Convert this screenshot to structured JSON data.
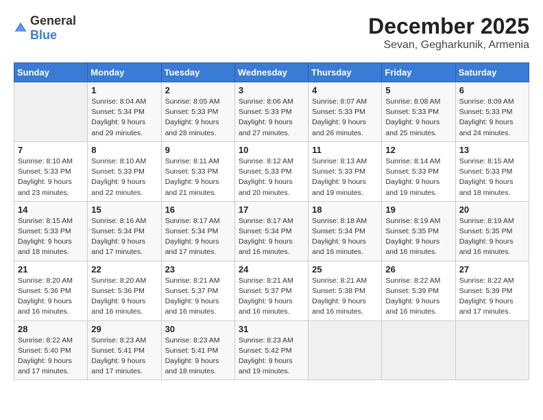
{
  "header": {
    "logo_general": "General",
    "logo_blue": "Blue",
    "month": "December 2025",
    "location": "Sevan, Gegharkunik, Armenia"
  },
  "weekdays": [
    "Sunday",
    "Monday",
    "Tuesday",
    "Wednesday",
    "Thursday",
    "Friday",
    "Saturday"
  ],
  "weeks": [
    [
      {
        "day": "",
        "empty": true
      },
      {
        "day": "1",
        "sunrise": "8:04 AM",
        "sunset": "5:34 PM",
        "daylight": "9 hours and 29 minutes."
      },
      {
        "day": "2",
        "sunrise": "8:05 AM",
        "sunset": "5:33 PM",
        "daylight": "9 hours and 28 minutes."
      },
      {
        "day": "3",
        "sunrise": "8:06 AM",
        "sunset": "5:33 PM",
        "daylight": "9 hours and 27 minutes."
      },
      {
        "day": "4",
        "sunrise": "8:07 AM",
        "sunset": "5:33 PM",
        "daylight": "9 hours and 26 minutes."
      },
      {
        "day": "5",
        "sunrise": "8:08 AM",
        "sunset": "5:33 PM",
        "daylight": "9 hours and 25 minutes."
      },
      {
        "day": "6",
        "sunrise": "8:09 AM",
        "sunset": "5:33 PM",
        "daylight": "9 hours and 24 minutes."
      }
    ],
    [
      {
        "day": "7",
        "sunrise": "8:10 AM",
        "sunset": "5:33 PM",
        "daylight": "9 hours and 23 minutes."
      },
      {
        "day": "8",
        "sunrise": "8:10 AM",
        "sunset": "5:33 PM",
        "daylight": "9 hours and 22 minutes."
      },
      {
        "day": "9",
        "sunrise": "8:11 AM",
        "sunset": "5:33 PM",
        "daylight": "9 hours and 21 minutes."
      },
      {
        "day": "10",
        "sunrise": "8:12 AM",
        "sunset": "5:33 PM",
        "daylight": "9 hours and 20 minutes."
      },
      {
        "day": "11",
        "sunrise": "8:13 AM",
        "sunset": "5:33 PM",
        "daylight": "9 hours and 19 minutes."
      },
      {
        "day": "12",
        "sunrise": "8:14 AM",
        "sunset": "5:33 PM",
        "daylight": "9 hours and 19 minutes."
      },
      {
        "day": "13",
        "sunrise": "8:15 AM",
        "sunset": "5:33 PM",
        "daylight": "9 hours and 18 minutes."
      }
    ],
    [
      {
        "day": "14",
        "sunrise": "8:15 AM",
        "sunset": "5:33 PM",
        "daylight": "9 hours and 18 minutes."
      },
      {
        "day": "15",
        "sunrise": "8:16 AM",
        "sunset": "5:34 PM",
        "daylight": "9 hours and 17 minutes."
      },
      {
        "day": "16",
        "sunrise": "8:17 AM",
        "sunset": "5:34 PM",
        "daylight": "9 hours and 17 minutes."
      },
      {
        "day": "17",
        "sunrise": "8:17 AM",
        "sunset": "5:34 PM",
        "daylight": "9 hours and 16 minutes."
      },
      {
        "day": "18",
        "sunrise": "8:18 AM",
        "sunset": "5:34 PM",
        "daylight": "9 hours and 16 minutes."
      },
      {
        "day": "19",
        "sunrise": "8:19 AM",
        "sunset": "5:35 PM",
        "daylight": "9 hours and 16 minutes."
      },
      {
        "day": "20",
        "sunrise": "8:19 AM",
        "sunset": "5:35 PM",
        "daylight": "9 hours and 16 minutes."
      }
    ],
    [
      {
        "day": "21",
        "sunrise": "8:20 AM",
        "sunset": "5:36 PM",
        "daylight": "9 hours and 16 minutes."
      },
      {
        "day": "22",
        "sunrise": "8:20 AM",
        "sunset": "5:36 PM",
        "daylight": "9 hours and 16 minutes."
      },
      {
        "day": "23",
        "sunrise": "8:21 AM",
        "sunset": "5:37 PM",
        "daylight": "9 hours and 16 minutes."
      },
      {
        "day": "24",
        "sunrise": "8:21 AM",
        "sunset": "5:37 PM",
        "daylight": "9 hours and 16 minutes."
      },
      {
        "day": "25",
        "sunrise": "8:21 AM",
        "sunset": "5:38 PM",
        "daylight": "9 hours and 16 minutes."
      },
      {
        "day": "26",
        "sunrise": "8:22 AM",
        "sunset": "5:39 PM",
        "daylight": "9 hours and 16 minutes."
      },
      {
        "day": "27",
        "sunrise": "8:22 AM",
        "sunset": "5:39 PM",
        "daylight": "9 hours and 17 minutes."
      }
    ],
    [
      {
        "day": "28",
        "sunrise": "8:22 AM",
        "sunset": "5:40 PM",
        "daylight": "9 hours and 17 minutes."
      },
      {
        "day": "29",
        "sunrise": "8:23 AM",
        "sunset": "5:41 PM",
        "daylight": "9 hours and 17 minutes."
      },
      {
        "day": "30",
        "sunrise": "8:23 AM",
        "sunset": "5:41 PM",
        "daylight": "9 hours and 18 minutes."
      },
      {
        "day": "31",
        "sunrise": "8:23 AM",
        "sunset": "5:42 PM",
        "daylight": "9 hours and 19 minutes."
      },
      {
        "day": "",
        "empty": true
      },
      {
        "day": "",
        "empty": true
      },
      {
        "day": "",
        "empty": true
      }
    ]
  ],
  "labels": {
    "sunrise": "Sunrise:",
    "sunset": "Sunset:",
    "daylight": "Daylight:"
  }
}
